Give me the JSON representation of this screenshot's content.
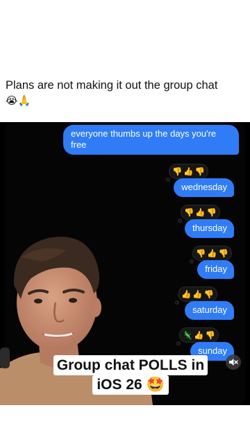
{
  "post": {
    "caption_text": "Plans are not making it out the group chat",
    "caption_emoji": "😭🙏"
  },
  "chat": {
    "first_message": "everyone thumbs up the days you're free",
    "days": [
      {
        "label": "wednesday",
        "reactions": [
          "👎",
          "👍",
          "👎"
        ]
      },
      {
        "label": "thursday",
        "reactions": [
          "👎",
          "👍",
          "👎"
        ]
      },
      {
        "label": "friday",
        "reactions": [
          "👎",
          "👍",
          "👎"
        ]
      },
      {
        "label": "saturday",
        "reactions": [
          "👍",
          "👍",
          "👎"
        ]
      },
      {
        "label": "sunday",
        "reactions": [
          "🦎",
          "👍",
          "👎"
        ]
      }
    ]
  },
  "overlay": {
    "title_line1": "Group chat POLLS in",
    "title_line2": "iOS 26 🤩"
  },
  "icons": {
    "mute": "speaker-muted-icon"
  },
  "colors": {
    "bubble_blue": "#2f7cf6",
    "screen_bg": "#050505"
  }
}
